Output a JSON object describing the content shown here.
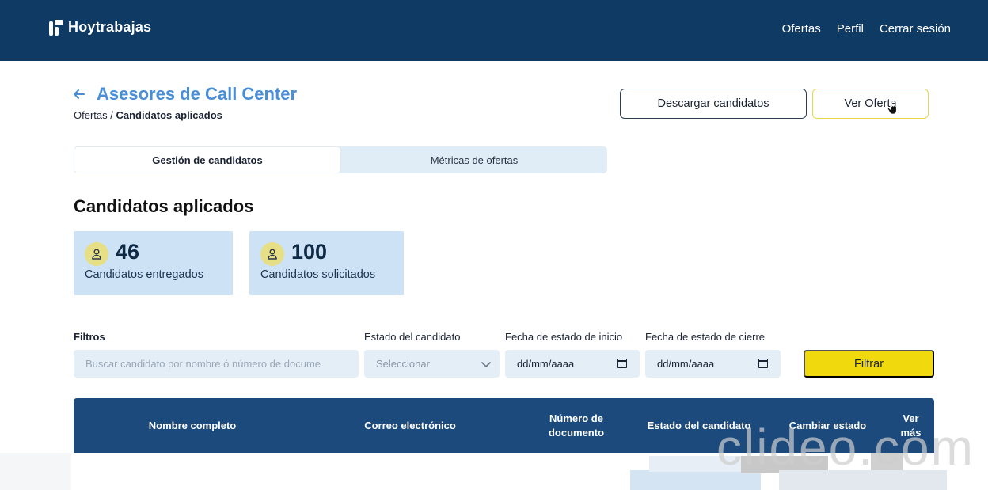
{
  "header": {
    "brand": "Hoytrabajas",
    "nav": [
      "Ofertas",
      "Perfil",
      "Cerrar sesión"
    ]
  },
  "page": {
    "back_icon": "arrow-left-icon",
    "title": "Asesores de Call Center",
    "breadcrumb": {
      "parent": "Ofertas",
      "separator": "/",
      "current": "Candidatos aplicados"
    },
    "actions": {
      "download": "Descargar candidatos",
      "view_offer": "Ver Oferta"
    }
  },
  "tabs": [
    {
      "label": "Gestión de candidatos",
      "active": true
    },
    {
      "label": "Métricas de ofertas",
      "active": false
    }
  ],
  "section_title": "Candidatos aplicados",
  "stats": [
    {
      "value": "46",
      "label": "Candidatos entregados",
      "icon": "user-icon"
    },
    {
      "value": "100",
      "label": "Candidatos solicitados",
      "icon": "user-icon"
    }
  ],
  "filters": {
    "title": "Filtros",
    "search_placeholder": "Buscar candidato por nombre ó número de docume",
    "state_label": "Estado del candidato",
    "state_value": "Seleccionar",
    "start_label": "Fecha de estado de inicio",
    "start_value": "dd/mm/aaaa",
    "end_label": "Fecha de estado de cierre",
    "end_value": "dd/mm/aaaa",
    "submit": "Filtrar"
  },
  "table": {
    "columns": [
      "Nombre completo",
      "Correo electrónico",
      "Número de documento",
      "Estado del candidato",
      "Cambiar estado",
      "Ver más"
    ]
  },
  "watermark": "clideo.com",
  "colors": {
    "header_bg": "#0f3a63",
    "accent_blue": "#4a8ed6",
    "accent_yellow": "#f0d90c",
    "table_head": "#1c4a7c",
    "stat_bg": "#cde3f5"
  }
}
